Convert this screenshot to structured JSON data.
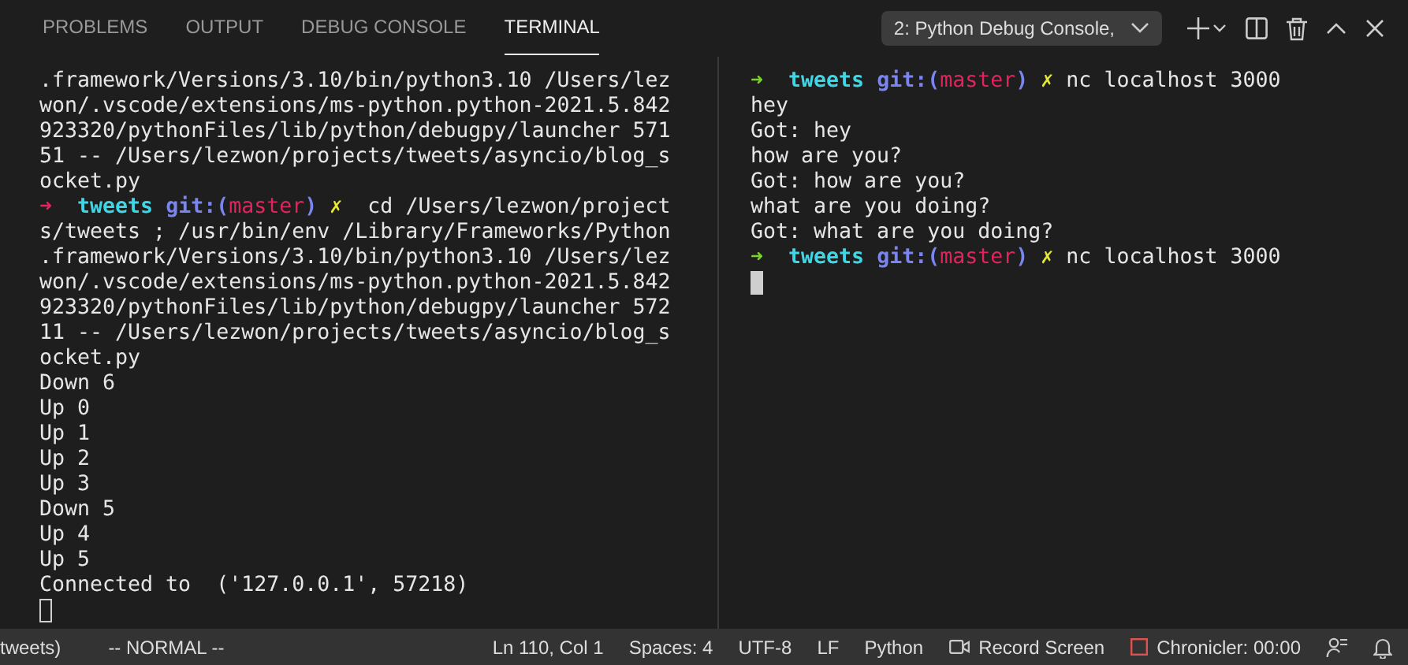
{
  "tabs": [
    {
      "label": "PROBLEMS",
      "selected": false
    },
    {
      "label": "OUTPUT",
      "selected": false
    },
    {
      "label": "DEBUG CONSOLE",
      "selected": false
    },
    {
      "label": "TERMINAL",
      "selected": true
    }
  ],
  "terminal_picker": {
    "value": "2: Python Debug Console,"
  },
  "panes": [
    {
      "focused": false,
      "lines": [
        {
          "kind": "output",
          "text": ".framework/Versions/3.10/bin/python3.10 /Users/lez"
        },
        {
          "kind": "output",
          "text": "won/.vscode/extensions/ms-python.python-2021.5.842"
        },
        {
          "kind": "output",
          "text": "923320/pythonFiles/lib/python/debugpy/launcher 571"
        },
        {
          "kind": "output",
          "text": "51 -- /Users/lezwon/projects/tweets/asyncio/blog_s"
        },
        {
          "kind": "output",
          "text": "ocket.py"
        },
        {
          "kind": "prompt",
          "failed": true,
          "arrow": "➜",
          "dir": "tweets",
          "git": "git:(",
          "branch": "master",
          "close": ")",
          "mark": "✗",
          "command": " cd /Users/lezwon/project"
        },
        {
          "kind": "output",
          "text": "s/tweets ; /usr/bin/env /Library/Frameworks/Python"
        },
        {
          "kind": "output",
          "text": ".framework/Versions/3.10/bin/python3.10 /Users/lez"
        },
        {
          "kind": "output",
          "text": "won/.vscode/extensions/ms-python.python-2021.5.842"
        },
        {
          "kind": "output",
          "text": "923320/pythonFiles/lib/python/debugpy/launcher 572"
        },
        {
          "kind": "output",
          "text": "11 -- /Users/lezwon/projects/tweets/asyncio/blog_s"
        },
        {
          "kind": "output",
          "text": "ocket.py"
        },
        {
          "kind": "output",
          "text": "Down 6"
        },
        {
          "kind": "output",
          "text": "Up 0"
        },
        {
          "kind": "output",
          "text": "Up 1"
        },
        {
          "kind": "output",
          "text": "Up 2"
        },
        {
          "kind": "output",
          "text": "Up 3"
        },
        {
          "kind": "output",
          "text": "Down 5"
        },
        {
          "kind": "output",
          "text": "Up 4"
        },
        {
          "kind": "output",
          "text": "Up 5"
        },
        {
          "kind": "output",
          "text": "Connected to  ('127.0.0.1', 57218)"
        },
        {
          "kind": "cursor"
        }
      ]
    },
    {
      "focused": true,
      "lines": [
        {
          "kind": "prompt",
          "failed": false,
          "arrow": "➜",
          "dir": "tweets",
          "git": "git:(",
          "branch": "master",
          "close": ")",
          "mark": "✗",
          "command": "nc localhost 3000"
        },
        {
          "kind": "output",
          "text": "hey"
        },
        {
          "kind": "output",
          "text": "Got: hey"
        },
        {
          "kind": "output",
          "text": "how are you?"
        },
        {
          "kind": "output",
          "text": "Got: how are you?"
        },
        {
          "kind": "output",
          "text": "what are you doing?"
        },
        {
          "kind": "output",
          "text": "Got: what are you doing?"
        },
        {
          "kind": "prompt",
          "failed": false,
          "arrow": "➜",
          "dir": "tweets",
          "git": "git:(",
          "branch": "master",
          "close": ")",
          "mark": "✗",
          "command": "nc localhost 3000"
        },
        {
          "kind": "cursor"
        }
      ]
    }
  ],
  "status_bar": {
    "left": [
      "tweets)",
      "-- NORMAL --"
    ],
    "right": [
      {
        "kind": "text",
        "label": "Ln 110, Col 1"
      },
      {
        "kind": "text",
        "label": "Spaces: 4"
      },
      {
        "kind": "text",
        "label": "UTF-8"
      },
      {
        "kind": "text",
        "label": "LF"
      },
      {
        "kind": "text",
        "label": "Python"
      },
      {
        "kind": "record",
        "label": "Record Screen"
      },
      {
        "kind": "chronicler",
        "label": "Chronicler: 00:00"
      },
      {
        "kind": "feedback"
      },
      {
        "kind": "bell"
      }
    ]
  }
}
